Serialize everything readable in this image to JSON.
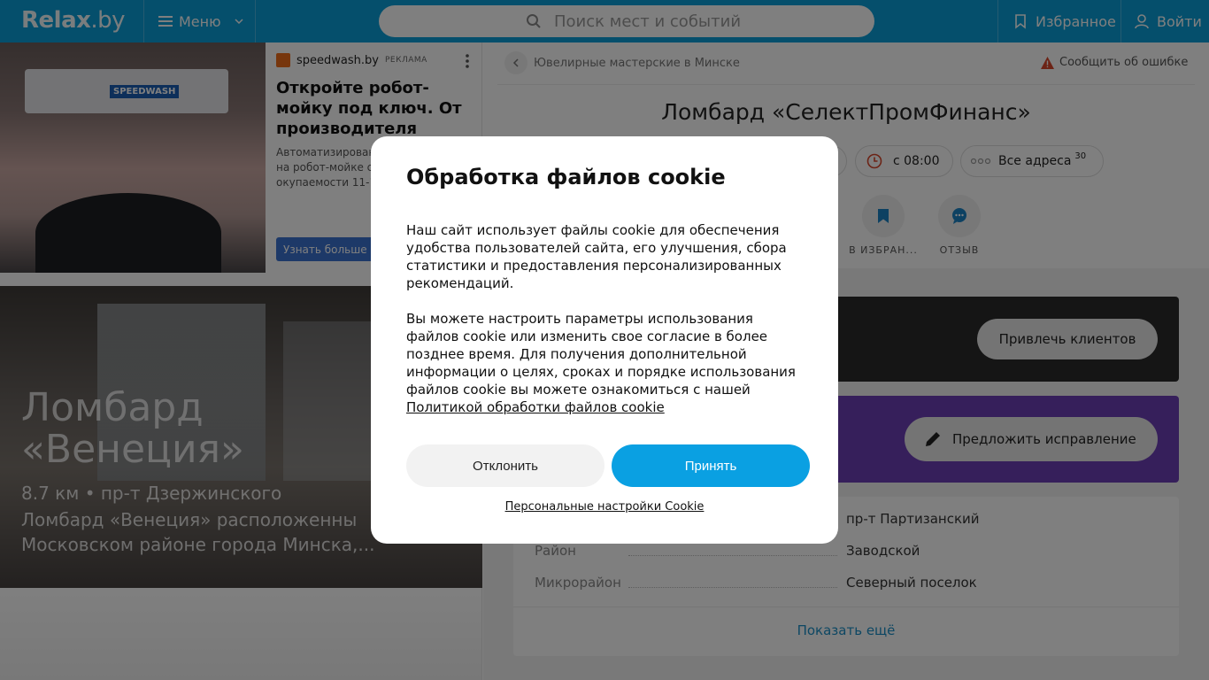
{
  "header": {
    "logo_main": "Relax",
    "logo_suffix": ".by",
    "menu_label": "Меню",
    "search_placeholder": "Поиск мест и событий",
    "favorites_label": "Избранное",
    "login_label": "Войти",
    "bg_color": "#0b9fd8"
  },
  "ad": {
    "brand": "speedwash.by",
    "tag": "РЕКЛАМА",
    "title": "Откройте робот-мойку под ключ. От производителя",
    "desc_line1": "Автоматизирован",
    "desc_line2": "на робот-мойке со",
    "desc_line3": "окупаемости 11-14",
    "button": "Узнать больше",
    "photo_badge": "SPEEDWASH"
  },
  "card": {
    "title_line1": "Ломбард",
    "title_line2": "«Венеция»",
    "meta": "8.7 км • пр-т Дзержинского",
    "desc_line1": "Ломбард «Венеция» расположенны",
    "desc_line2": "Московском районе города Минска,..."
  },
  "page": {
    "breadcrumb": "Ювелирные мастерские в Минске",
    "report": "Сообщить об ошибке",
    "title": "Ломбард «СелектПромФинанс»",
    "hours": "с 08:00",
    "addresses_label": "Все адреса",
    "addresses_count": "30",
    "action_favorite": "В ИЗБРАН...",
    "action_review": "ОТЗЫВ",
    "attract_button": "Привлечь клиентов",
    "suggest_button": "Предложить исправление",
    "info": [
      {
        "key": "",
        "value": "пр-т Партизанский"
      },
      {
        "key": "Район",
        "value": "Заводской"
      },
      {
        "key": "Микрорайон",
        "value": "Северный поселок"
      }
    ],
    "show_more": "Показать ещё"
  },
  "cookie": {
    "title": "Обработка файлов cookie",
    "p1": "Наш сайт использует файлы cookie для обеспечения удобства пользователей сайта, его улучшения, сбора статистики и предоставления персонализированных рекомендаций.",
    "p2": "Вы можете настроить параметры использования файлов cookie или изменить свое согласие в более позднее время. Для получения дополнительной информации о целях, сроках и порядке использования файлов cookie вы можете ознакомиться с нашей",
    "policy_link": "Политикой обработки файлов cookie",
    "decline": "Отклонить",
    "accept": "Принять",
    "personal": "Персональные настройки Cookie",
    "accent_color": "#0aa0e2"
  }
}
